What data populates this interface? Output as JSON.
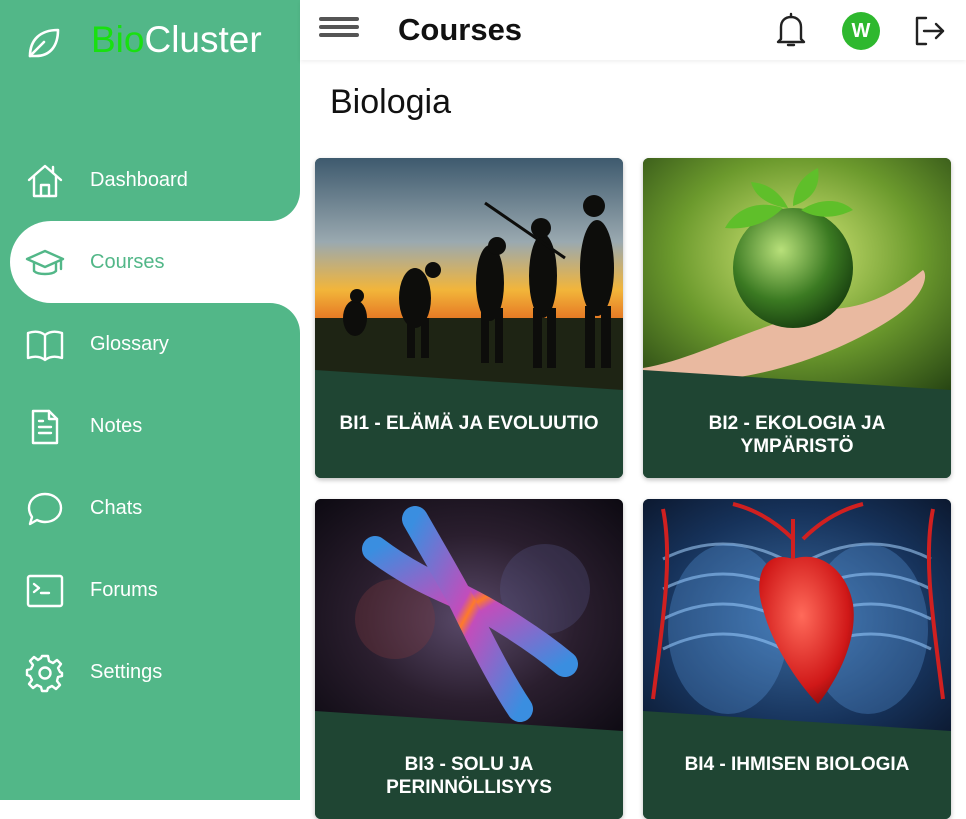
{
  "brand": {
    "part1": "Bio",
    "part2": "Cluster"
  },
  "topbar": {
    "title": "Courses",
    "avatar_initial": "W"
  },
  "nav": [
    {
      "label": "Dashboard",
      "icon": "home-icon"
    },
    {
      "label": "Courses",
      "icon": "graduation-cap-icon",
      "active": true
    },
    {
      "label": "Glossary",
      "icon": "book-icon"
    },
    {
      "label": "Notes",
      "icon": "document-icon"
    },
    {
      "label": "Chats",
      "icon": "chat-bubble-icon"
    },
    {
      "label": "Forums",
      "icon": "terminal-icon"
    },
    {
      "label": "Settings",
      "icon": "gear-icon"
    }
  ],
  "page": {
    "title": "Biologia"
  },
  "courses": [
    {
      "title": "BI1 - ELÄMÄ JA EVOLUUTIO",
      "image": "evolution-silhouettes"
    },
    {
      "title": "BI2 - EKOLOGIA JA YMPÄRISTÖ",
      "image": "green-globe-in-hand"
    },
    {
      "title": "BI3 - SOLU JA PERINNÖLLISYYS",
      "image": "chromosome"
    },
    {
      "title": "BI4 - IHMISEN BIOLOGIA",
      "image": "heart-and-lungs"
    }
  ],
  "colors": {
    "sidebar": "#52b788",
    "brand_accent": "#18e010",
    "card_band": "#1f4533",
    "avatar": "#2eb82e"
  }
}
